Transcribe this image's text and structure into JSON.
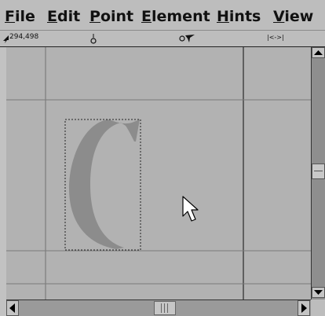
{
  "menubar": {
    "items": [
      {
        "label": "File",
        "mnemonic": "F",
        "rest": "ile"
      },
      {
        "label": "Edit",
        "mnemonic": "E",
        "rest": "dit"
      },
      {
        "label": "Point",
        "mnemonic": "P",
        "rest": "oint"
      },
      {
        "label": "Element",
        "mnemonic": "E",
        "rest": "lement"
      },
      {
        "label": "Hints",
        "mnemonic": "H",
        "rest": "ints"
      },
      {
        "label": "View",
        "mnemonic": "V",
        "rest": "iew"
      }
    ]
  },
  "infobar": {
    "coordinates": "294,498",
    "cursor_icon": "arrow-pointer-icon",
    "point_icon": "point-marker-icon",
    "tool_icon": "knife-tool-icon",
    "width_icon": "width-measure-icon",
    "width_text": "|<->|"
  },
  "editor": {
    "glyph": "C",
    "glyph_color": "#8c8c8c",
    "canvas_color": "#b2b2b2",
    "guide_color": "#707070"
  }
}
